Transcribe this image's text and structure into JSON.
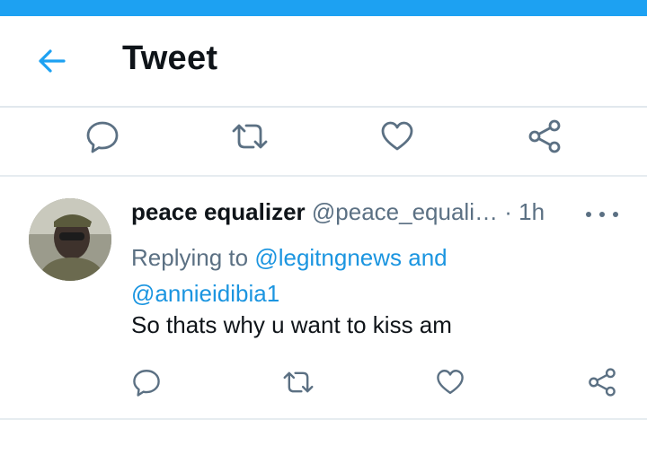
{
  "header": {
    "title": "Tweet",
    "back_icon": "arrow-left-icon"
  },
  "colors": {
    "accent": "#1da1f2",
    "link": "#1b95e0",
    "muted": "#5b7083",
    "divider": "#e1e8ed"
  },
  "top_actions": {
    "icons": [
      "reply-icon",
      "retweet-icon",
      "like-icon",
      "share-icon"
    ]
  },
  "tweet": {
    "display_name": "peace equalizer",
    "handle": "@peace_equali…",
    "separator": "·",
    "time": "1h",
    "replying_prefix": "Replying to",
    "reply_to_1": "@legitngnews",
    "reply_to_joiner": "and",
    "reply_to_2": "@annieidibia1",
    "text": "So thats why u want to kiss am",
    "more_icon": "more-horizontal-icon",
    "actions": [
      "reply-icon",
      "retweet-icon",
      "like-icon",
      "share-icon"
    ]
  }
}
